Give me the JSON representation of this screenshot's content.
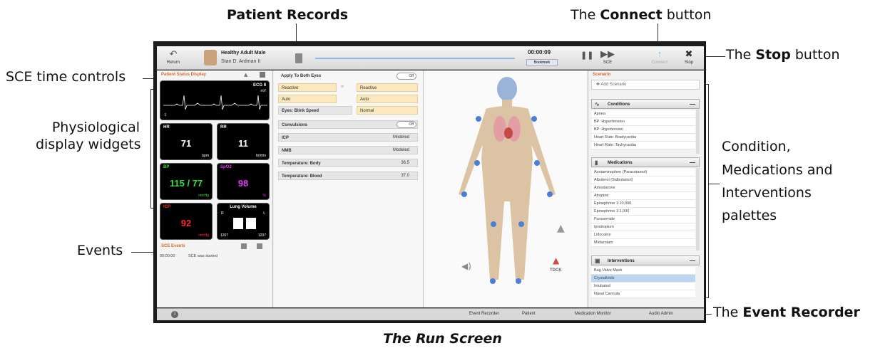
{
  "callouts": {
    "patient_records": "Patient Records",
    "connect_prefix": "The ",
    "connect_bold": "Connect",
    "connect_suffix": " button",
    "stop_prefix": "The ",
    "stop_bold": "Stop",
    "stop_suffix": " button",
    "sce_time_controls": "SCE time controls",
    "physio_line1": "Physiological",
    "physio_line2": "display widgets",
    "events": "Events",
    "palettes_line1": "Condition,",
    "palettes_line2": "Medications and",
    "palettes_line3": "Interventions",
    "palettes_line4": "palettes",
    "event_rec_prefix": "The ",
    "event_rec_bold": "Event Recorder"
  },
  "caption": "The Run Screen",
  "toolbar": {
    "return_label": "Return",
    "patient_name": "Healthy Adult Male",
    "patient_sub": "Stan D. Ardman II",
    "timer": "00:00:09",
    "bookmark_label": "Bookmark",
    "sce_label": "SCE",
    "connect_label": "Connect",
    "stop_label": "Stop"
  },
  "left_panel": {
    "title": "Patient Status Display",
    "ecg_label": "ECG II",
    "ecg_unit": "mV",
    "ecg_scale": "-1",
    "hr": {
      "label": "HR",
      "value": "71",
      "unit": "bpm"
    },
    "rr": {
      "label": "RR",
      "value": "11",
      "unit": "br/min"
    },
    "bp": {
      "label": "BP",
      "value": "115 / 77",
      "unit": "mmHg"
    },
    "spo2": {
      "label": "SpO2",
      "value": "98",
      "unit": "%"
    },
    "icp": {
      "label": "ICP",
      "value": "92",
      "unit": "mmHg"
    },
    "lung": {
      "label": "Lung Volume",
      "r": "R",
      "l": "L",
      "val_r": "1207",
      "val_l": "1207"
    },
    "events_title": "SCE Events",
    "event_time": "00:00:00",
    "event_text": "SCE was started"
  },
  "mid_panel": {
    "apply_both": "Apply To Both Eyes",
    "off": "Off",
    "reactive": "Reactive",
    "auto": "Auto",
    "blink_speed": "Eyes: Blink Speed",
    "normal": "Normal",
    "convulsions": "Convulsions",
    "icp": "ICP",
    "icp_val": "Modeled",
    "nmb": "NMB",
    "nmb_val": "Modeled",
    "temp_body": "Temperature: Body",
    "temp_body_val": "36.5",
    "temp_blood": "Temperature: Blood",
    "temp_blood_val": "37.0"
  },
  "body_area": {
    "tdck_label": "TDCK"
  },
  "right_panel": {
    "title": "Scenario",
    "add_scenario": "Add Scenario",
    "conditions_title": "Conditions",
    "conditions": [
      "Apnea",
      "BP: Hypertension",
      "BP: Hypotension",
      "Heart Rate: Bradycardia",
      "Heart Rate: Tachycardia"
    ],
    "medications_title": "Medications",
    "medications": [
      "Acetaminophen (Paracetamol)",
      "Albuterol (Salbutamol)",
      "Amiodarone",
      "Atropine",
      "Epinephrine 1:10,000",
      "Epinephrine 1:1,000",
      "Furosemide",
      "Ipratropium",
      "Lidocaine",
      "Midazolam"
    ],
    "interventions_title": "Interventions",
    "interventions": [
      "Bag Valve Mask",
      "Crystalloids",
      "Intubated",
      "Nasal Cannula"
    ],
    "selected_intervention": "Crystalloids"
  },
  "status_bar": {
    "event_recorder": "Event Recorder",
    "patient": "Patient",
    "medication_monitor": "Medication Monitor",
    "audio_label": "Audio Admin"
  },
  "colors": {
    "hr": "#ffffff",
    "bp": "#36e23a",
    "spo2": "#e13cf0",
    "icp": "#ff2a2a",
    "accent_orange": "#d86a2a",
    "blue_dot": "#4a7fd8"
  }
}
